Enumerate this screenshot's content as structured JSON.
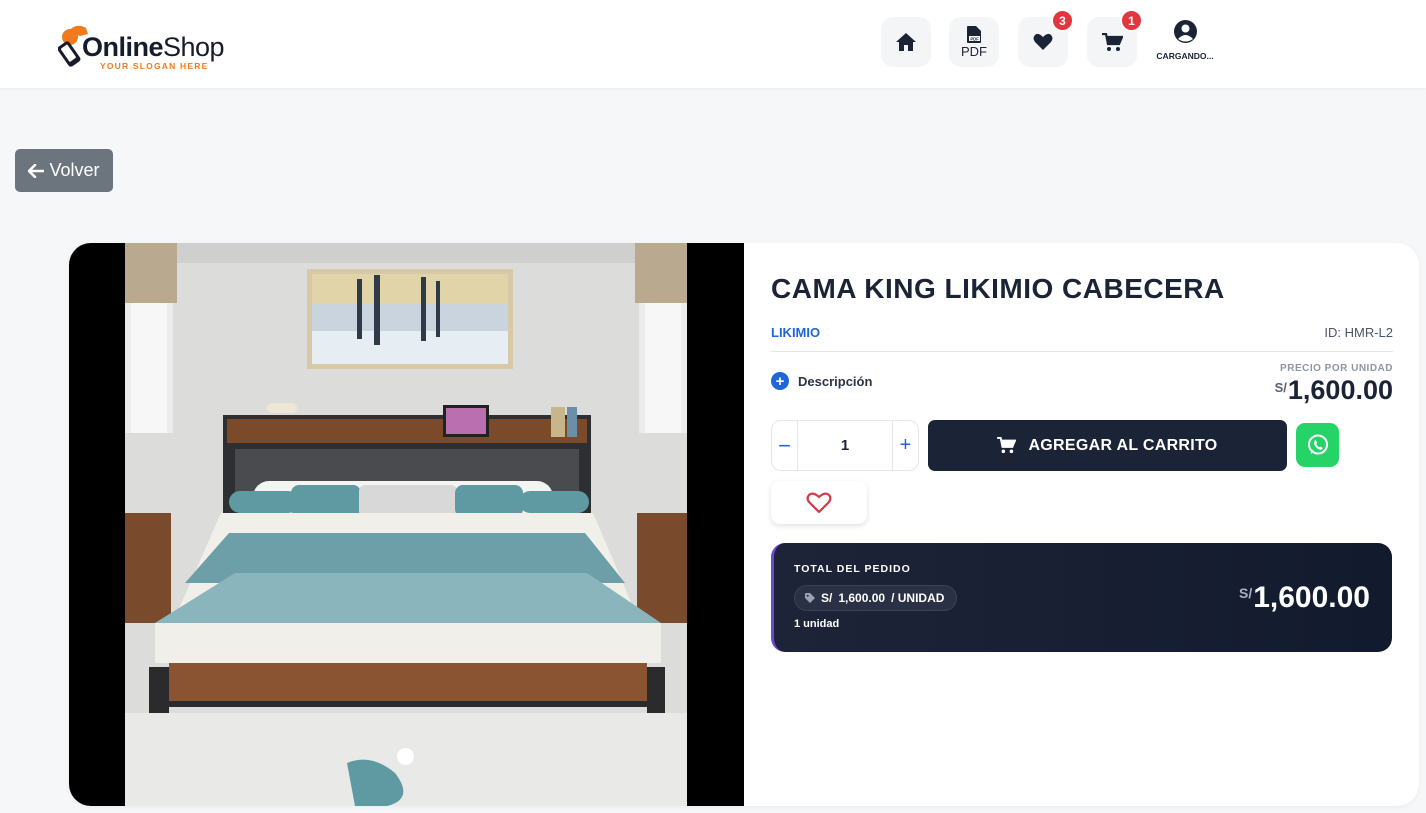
{
  "header": {
    "logo_bold": "Online",
    "logo_light": "Shop",
    "slogan": "YOUR SLOGAN HERE",
    "pdf_label": "PDF",
    "favorites_count": "3",
    "cart_count": "1",
    "user_label": "CARGANDO..."
  },
  "back_label": "Volver",
  "product": {
    "title": "CAMA KING LIKIMIO CABECERA",
    "brand": "LIKIMIO",
    "id_text": "ID: HMR-L2",
    "description_label": "Descripción",
    "unit_price_label": "PRECIO POR UNIDAD",
    "currency": "S/",
    "unit_price": "1,600.00",
    "quantity": "1",
    "minus": "−",
    "plus": "+",
    "add_to_cart_label": "AGREGAR AL CARRITO"
  },
  "order": {
    "label": "TOTAL DEL PEDIDO",
    "pill_currency": "S/",
    "pill_amount": "1,600.00",
    "pill_unit": "/ UNIDAD",
    "units": "1 unidad",
    "currency": "S/",
    "total": "1,600.00"
  },
  "colors": {
    "accent": "#1f66d6",
    "dark": "#1b2336",
    "badge": "#e2363f",
    "whatsapp": "#25d366",
    "logo_orange": "#f07a1c"
  },
  "icons": [
    "home-icon",
    "pdf-file-icon",
    "heart-icon",
    "cart-icon",
    "user-circle-icon",
    "arrow-left-icon",
    "plus-circle-icon",
    "whatsapp-icon",
    "tag-icon"
  ]
}
